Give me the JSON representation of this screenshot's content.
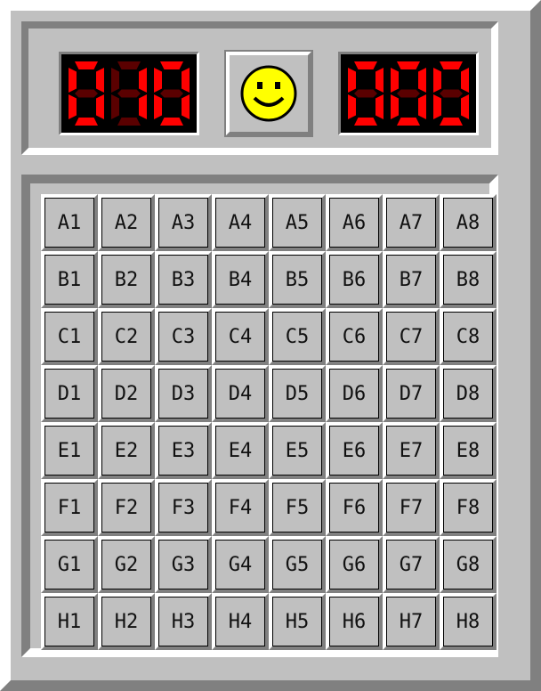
{
  "mine_counter": {
    "value": "010"
  },
  "timer": {
    "value": "000"
  },
  "face": {
    "state": "smile",
    "icon": "smiley-face-icon",
    "color": "#ffff00"
  },
  "colors": {
    "led_on": "#ff0000",
    "led_off": "#5a0000",
    "face_bg": "#c0c0c0"
  },
  "board": {
    "rows": [
      "A",
      "B",
      "C",
      "D",
      "E",
      "F",
      "G",
      "H"
    ],
    "cols": [
      "1",
      "2",
      "3",
      "4",
      "5",
      "6",
      "7",
      "8"
    ],
    "cells": [
      [
        "A1",
        "A2",
        "A3",
        "A4",
        "A5",
        "A6",
        "A7",
        "A8"
      ],
      [
        "B1",
        "B2",
        "B3",
        "B4",
        "B5",
        "B6",
        "B7",
        "B8"
      ],
      [
        "C1",
        "C2",
        "C3",
        "C4",
        "C5",
        "C6",
        "C7",
        "C8"
      ],
      [
        "D1",
        "D2",
        "D3",
        "D4",
        "D5",
        "D6",
        "D7",
        "D8"
      ],
      [
        "E1",
        "E2",
        "E3",
        "E4",
        "E5",
        "E6",
        "E7",
        "E8"
      ],
      [
        "F1",
        "F2",
        "F3",
        "F4",
        "F5",
        "F6",
        "F7",
        "F8"
      ],
      [
        "G1",
        "G2",
        "G3",
        "G4",
        "G5",
        "G6",
        "G7",
        "G8"
      ],
      [
        "H1",
        "H2",
        "H3",
        "H4",
        "H5",
        "H6",
        "H7",
        "H8"
      ]
    ]
  }
}
